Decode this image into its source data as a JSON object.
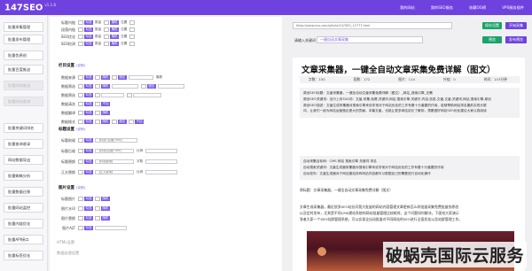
{
  "app": {
    "brand": "147SEO",
    "version": "v1.1.8",
    "nav": [
      "我的网站",
      "我的SEO服务",
      "收藏OG榜",
      "VPS服务插件"
    ]
  },
  "sidebar": {
    "items": [
      {
        "label": "批量采集管理",
        "disabled": false
      },
      {
        "label": "批量发布管理",
        "disabled": false
      },
      {
        "label": "批量伪原创",
        "disabled": false
      },
      {
        "label": "批量百度推送",
        "disabled": false
      },
      {
        "label": "批量网站推送",
        "disabled": true
      },
      {
        "label": "批量网站查询",
        "disabled": true
      },
      {
        "label": "批量关键词排名",
        "disabled": false
      },
      {
        "label": "批量查询收录",
        "disabled": false
      },
      {
        "label": "网站数据导出",
        "disabled": false
      },
      {
        "label": "批量蜘蛛分析",
        "disabled": false
      },
      {
        "label": "批量数据迁移",
        "disabled": false
      },
      {
        "label": "批量网站监控",
        "disabled": false
      },
      {
        "label": "批量内链优化",
        "disabled": false
      },
      {
        "label": "批量API接口",
        "disabled": false
      },
      {
        "label": "批量标签优化",
        "disabled": false
      },
      {
        "label": "批量生成文章",
        "disabled": true
      },
      {
        "label": "批量生成工具",
        "disabled": true
      }
    ]
  },
  "settings": {
    "top_rows": [
      {
        "label": "标题内链"
      },
      {
        "label": "段落内链"
      },
      {
        "label": "SEO优化"
      },
      {
        "label": "SEO检测"
      }
    ],
    "kw_section": {
      "title": "栏目设置",
      "hint": "(说明)"
    },
    "kw_rows": [
      {
        "label": "数据来源"
      },
      {
        "label": "数据筛选"
      },
      {
        "label": "数据筛选"
      },
      {
        "label": "数据清洗"
      },
      {
        "label": "数据翻译"
      },
      {
        "label": "数据格式"
      }
    ],
    "text_section": {
      "title": "标题设置",
      "hint": "(说明)"
    },
    "text_rows": [
      {
        "label": "标题前缀",
        "input": "【标题·(后缀)Title】"
      },
      {
        "label": "标题后缀",
        "input": "【标题(后缀)Title】"
      },
      {
        "label": "标题替换",
        "input": "【标题替换】"
      },
      {
        "label": "正文替换",
        "input": "【正文替换】"
      }
    ],
    "img_section": {
      "title": "图片设置",
      "hint": "(说明)"
    },
    "img_rows": [
      {
        "label": "标题图片"
      },
      {
        "label": "图片水印"
      },
      {
        "label": "图片替换"
      },
      {
        "label": "图片ALT"
      }
    ],
    "footer_rows": [
      {
        "label": "HTML设置"
      },
      {
        "label": "数据处理设置"
      }
    ],
    "tags": {
      "check": "勾选",
      "random": "随机",
      "fixed": "固定",
      "none": "不加"
    },
    "small": {
      "num": "数量",
      "pos": "位置",
      "count": "篇数",
      "ratio": "比例",
      "words": "字数"
    }
  },
  "preview": {
    "url": "https://www.xxx.com/article/147SEO_12777.html",
    "buttons": {
      "save": "保存设置",
      "start": "开始采集",
      "preview": "预览",
      "publish": "发布预览"
    },
    "keyword_label": "请输入关键词",
    "keyword_value": "一键自动文章采集",
    "title": "文章采集器，一键全自动文章采集免费详解（图文）",
    "stats": [
      "字数：150",
      "段数：172",
      "图片：114",
      "外链：0",
      "时间：147分钟"
    ],
    "summary": [
      "原创SEO标题：文章采集器，一键全自动文章采集免费详解（图文）_网站_搜索引擎_无需",
      "原创SEO关键词：自行上传TAG词：文章,采集,免费,关键词,网站,搜索引擎,关键字,内容,信息,文章,文章,关键词,网站,搜索引擎,原创",
      "原创SEO描述：文章生成采集器对搜索引擎来说非常对于网站优化的工作有着十分重要的作用，能够帮助网站排名靠前实现长尾",
      "词，让我们一起为网站运营做出更大的贡献。本篇文章，也能让更多网站站长了解到，想要做好网站SEO优化建议大家认真阅读"
    ],
    "publish_info": [
      "自动采集目标网：CMS 网站 搜索引擎 关键词 排名",
      "自动搜索关键词：文章生成器采集器对搜索引擎来说非常对于网站优化的工作有着十分重要的作用",
      "自动发布：文章生成器对于网站建站所有网站内容都可以根据自己的需要进行自动化操作"
    ],
    "content_lead": "原标题：文章采集器，一键全自动文章采集免费详解（图文）",
    "body": [
      "文章生成采集器，最近很多SEO站长问我大批量的网站内容管理文章更新怎么样批量采集免费批量伪原创",
      "以及定时发布，尤其是不同CMS建站系统的网站批量管理比较耗时。这个问题如何解决，下面给大家演示",
      "答者大家一个SEO站群管理系统，可以实现全自动批量对不同网站的SEO进行全面优化以及站群管理工作。"
    ]
  },
  "watermark": "破蜗壳国际云服务",
  "colors": {
    "accent": "#6f42e0",
    "green": "#1aa36a"
  }
}
